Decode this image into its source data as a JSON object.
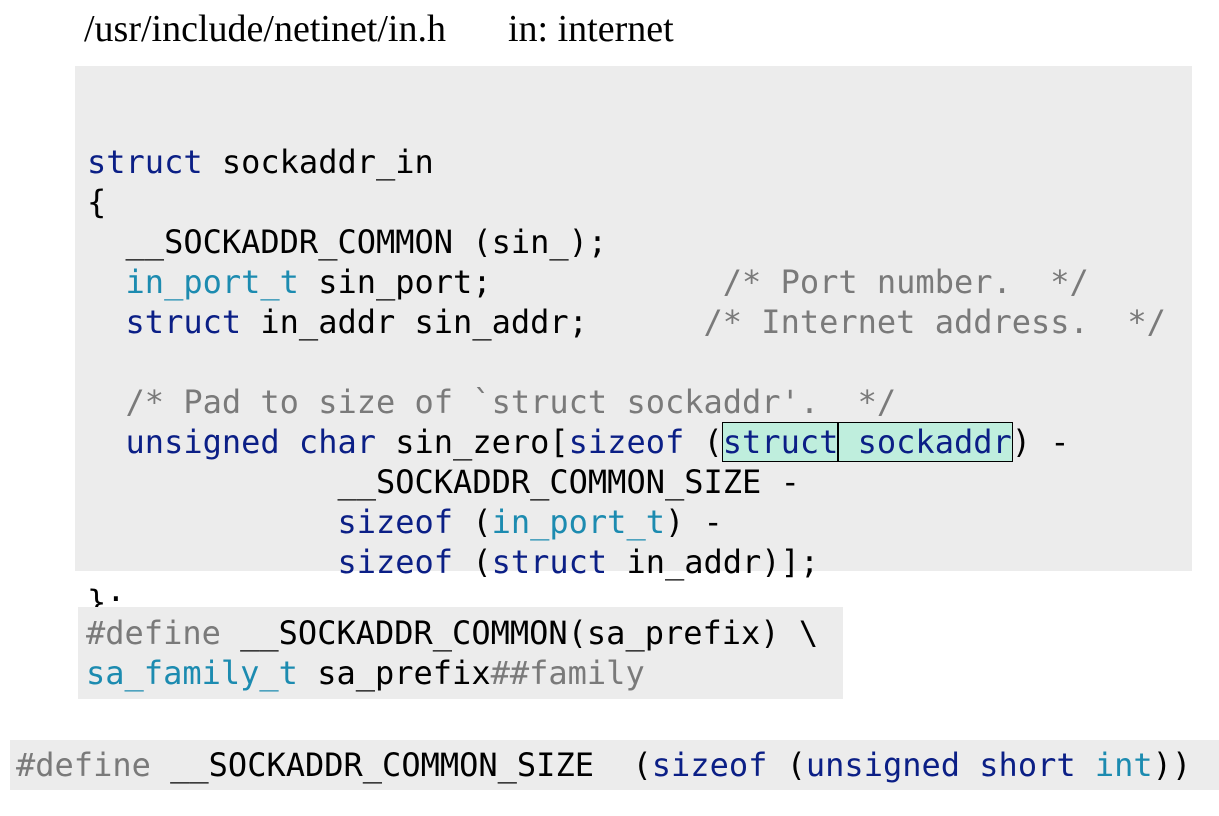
{
  "header": {
    "path": "/usr/include/netinet/in.h",
    "note": "in: internet"
  },
  "struct_block": {
    "lines": [
      [
        {
          "t": "struct",
          "c": "kw"
        },
        {
          "t": " sockaddr_in",
          "c": ""
        }
      ],
      [
        {
          "t": "{",
          "c": ""
        }
      ],
      [
        {
          "t": "  __SOCKADDR_COMMON (sin_);",
          "c": ""
        }
      ],
      [
        {
          "t": "  ",
          "c": ""
        },
        {
          "t": "in_port_t",
          "c": "ty"
        },
        {
          "t": " sin_port;            ",
          "c": ""
        },
        {
          "t": "/* Port number.  */",
          "c": "cm"
        }
      ],
      [
        {
          "t": "  ",
          "c": ""
        },
        {
          "t": "struct",
          "c": "kw"
        },
        {
          "t": " in_addr sin_addr;      ",
          "c": ""
        },
        {
          "t": "/* Internet address.  */",
          "c": "cm"
        }
      ],
      [
        {
          "t": "",
          "c": ""
        }
      ],
      [
        {
          "t": "  ",
          "c": ""
        },
        {
          "t": "/* Pad to size of `struct sockaddr'.  */",
          "c": "cm"
        }
      ],
      [
        {
          "t": "  ",
          "c": ""
        },
        {
          "t": "unsigned",
          "c": "kw"
        },
        {
          "t": " ",
          "c": ""
        },
        {
          "t": "char",
          "c": "kw"
        },
        {
          "t": " sin_zero[",
          "c": ""
        },
        {
          "t": "sizeof",
          "c": "kw"
        },
        {
          "t": " (",
          "c": ""
        },
        {
          "t": "struct",
          "c": "kw hl"
        },
        {
          "t": " sockaddr",
          "c": "kw hl"
        },
        {
          "t": ") -",
          "c": ""
        }
      ],
      [
        {
          "t": "             __SOCKADDR_COMMON_SIZE -",
          "c": ""
        }
      ],
      [
        {
          "t": "             ",
          "c": ""
        },
        {
          "t": "sizeof",
          "c": "kw"
        },
        {
          "t": " (",
          "c": ""
        },
        {
          "t": "in_port_t",
          "c": "ty"
        },
        {
          "t": ") -",
          "c": ""
        }
      ],
      [
        {
          "t": "             ",
          "c": ""
        },
        {
          "t": "sizeof",
          "c": "kw"
        },
        {
          "t": " (",
          "c": ""
        },
        {
          "t": "struct",
          "c": "kw"
        },
        {
          "t": " in_addr)];",
          "c": ""
        }
      ],
      [
        {
          "t": "};",
          "c": ""
        }
      ]
    ]
  },
  "define_common": {
    "lines": [
      [
        {
          "t": "#define",
          "c": "pp"
        },
        {
          "t": " __SOCKADDR_COMMON(sa_prefix) \\",
          "c": ""
        }
      ],
      [
        {
          "t": "sa_family_t",
          "c": "ty"
        },
        {
          "t": " sa_prefix",
          "c": ""
        },
        {
          "t": "##family",
          "c": "pp"
        }
      ]
    ]
  },
  "define_size": {
    "lines": [
      [
        {
          "t": "#define",
          "c": "pp"
        },
        {
          "t": " __SOCKADDR_COMMON_SIZE  (",
          "c": ""
        },
        {
          "t": "sizeof",
          "c": "kw"
        },
        {
          "t": " (",
          "c": ""
        },
        {
          "t": "unsigned",
          "c": "kw"
        },
        {
          "t": " ",
          "c": ""
        },
        {
          "t": "short",
          "c": "kw"
        },
        {
          "t": " ",
          "c": ""
        },
        {
          "t": "int",
          "c": "ty"
        },
        {
          "t": "))",
          "c": ""
        }
      ]
    ]
  }
}
